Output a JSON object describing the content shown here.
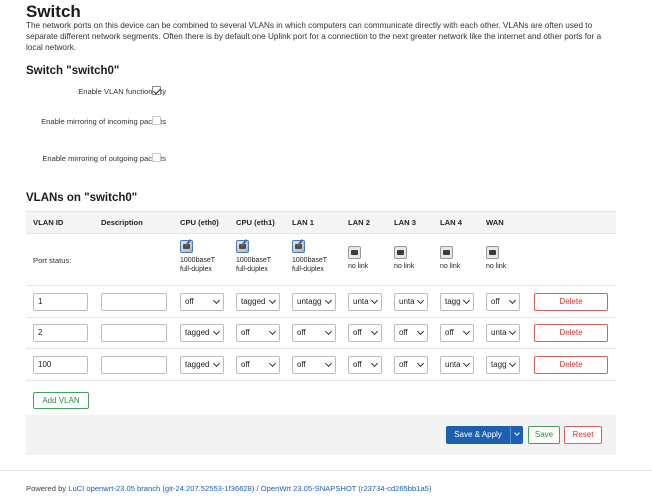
{
  "page": {
    "title": "Switch",
    "intro": "The network ports on this device can be combined to several VLANs in which computers can communicate directly with each other. VLANs are often used to separate different network segments. Often there is by default one Uplink port for a connection to the next greater network like the internet and other ports for a local network."
  },
  "switch_section": {
    "title": "Switch \"switch0\"",
    "options": [
      {
        "label": "Enable VLAN functionality",
        "checked": true
      },
      {
        "label": "Enable mirroring of incoming packets",
        "checked": false
      },
      {
        "label": "Enable mirroring of outgoing packets",
        "checked": false
      }
    ]
  },
  "vlans_section": {
    "title": "VLANs on \"switch0\"",
    "columns": [
      "VLAN ID",
      "Description",
      "CPU (eth0)",
      "CPU (eth1)",
      "LAN 1",
      "LAN 2",
      "LAN 3",
      "LAN 4",
      "WAN"
    ],
    "port_status_label": "Port status:",
    "port_status": [
      {
        "icon": "ethernet-up-icon",
        "line1": "1000baseT",
        "line2": "full-duplex"
      },
      {
        "icon": "ethernet-up-icon",
        "line1": "1000baseT",
        "line2": "full-duplex"
      },
      {
        "icon": "ethernet-up-icon",
        "line1": "1000baseT",
        "line2": "full-duplex"
      },
      {
        "icon": "ethernet-down-icon",
        "line1": "no link",
        "line2": ""
      },
      {
        "icon": "ethernet-down-icon",
        "line1": "no link",
        "line2": ""
      },
      {
        "icon": "ethernet-down-icon",
        "line1": "no link",
        "line2": ""
      },
      {
        "icon": "ethernet-down-icon",
        "line1": "no link",
        "line2": ""
      }
    ],
    "rows": [
      {
        "vlan_id": "1",
        "description": "",
        "ports": [
          "off",
          "tagged",
          "untagg",
          "unta",
          "unta",
          "tagg",
          "off"
        ]
      },
      {
        "vlan_id": "2",
        "description": "",
        "ports": [
          "tagged",
          "off",
          "off",
          "off",
          "off",
          "off",
          "unta"
        ]
      },
      {
        "vlan_id": "100",
        "description": "",
        "ports": [
          "tagged",
          "off",
          "off",
          "off",
          "off",
          "unta",
          "tagg"
        ]
      }
    ],
    "delete_label": "Delete",
    "add_label": "Add VLAN"
  },
  "actions": {
    "save_apply_label": "Save & Apply",
    "save_label": "Save",
    "reset_label": "Reset"
  },
  "footer": {
    "prefix": "Powered by ",
    "luci_link": "LuCI openwrt-23.05 branch (git-24.207.52553-1f36628)",
    "separator": " / ",
    "openwrt_link": "OpenWrt 23.05-SNAPSHOT (r23734-cd265bb1a5)"
  },
  "colors": {
    "primary": "#1d5fb3",
    "positive": "#2e8b44",
    "negative": "#d9342b"
  }
}
